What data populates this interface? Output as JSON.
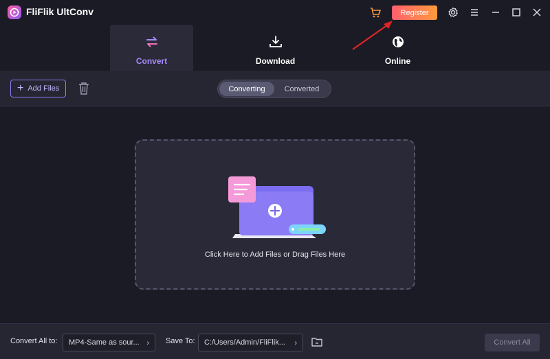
{
  "app": {
    "title": "FliFlik UltConv"
  },
  "header": {
    "register_label": "Register",
    "icons": [
      "cart-icon",
      "gear-icon",
      "menu-icon",
      "minimize-icon",
      "maximize-icon",
      "close-icon"
    ]
  },
  "tabs": [
    {
      "label": "Convert",
      "icon": "convert-arrows-icon",
      "active": true
    },
    {
      "label": "Download",
      "icon": "download-icon",
      "active": false
    },
    {
      "label": "Online",
      "icon": "globe-icon",
      "active": false
    }
  ],
  "toolbar": {
    "add_files_label": "Add Files",
    "segments": [
      "Converting",
      "Converted"
    ],
    "active_segment": "Converting"
  },
  "dropzone": {
    "text": "Click Here to Add Files or Drag Files Here"
  },
  "bottom": {
    "convert_all_to_label": "Convert All to:",
    "format_value": "MP4-Same as sour...",
    "save_to_label": "Save To:",
    "save_path": "C:/Users/Admin/FliFlik...",
    "convert_all_button": "Convert All"
  },
  "colors": {
    "accent": "#a78bfa",
    "register_start": "#ff5f6d",
    "register_end": "#ff9a3c",
    "background": "#1b1b26",
    "annotation_arrow": "#e02424"
  }
}
